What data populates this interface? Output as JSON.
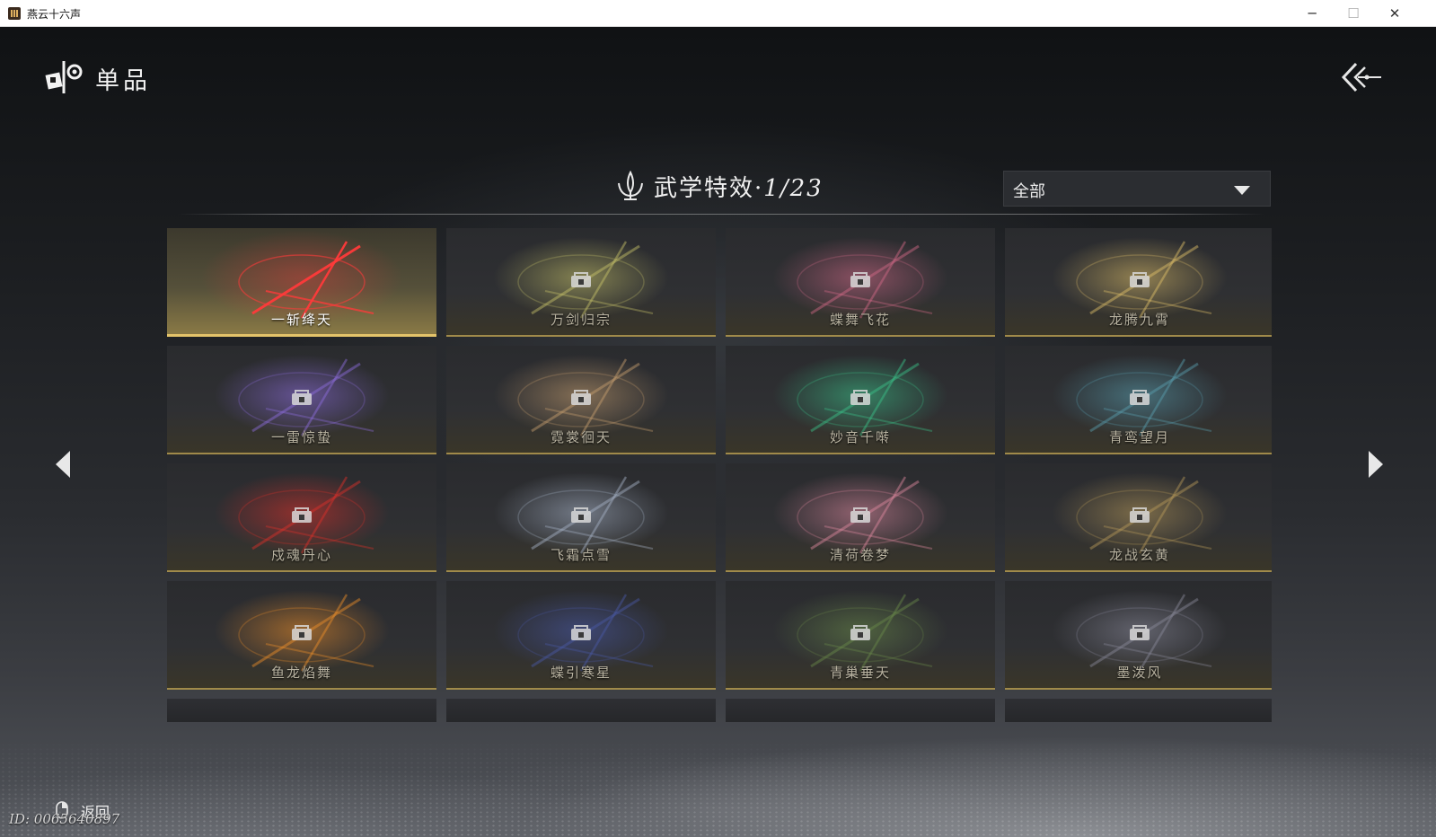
{
  "window": {
    "title": "燕云十六声",
    "minimize_glyph": "─",
    "maximize_glyph": "☐",
    "close_glyph": "✕"
  },
  "header": {
    "title": "单品",
    "icon": "item-shop-icon",
    "back_icon": "double-chevron-left-icon"
  },
  "section": {
    "title": "武学特效",
    "separator": "·",
    "count": "1/23",
    "icon": "lotus-emblem-icon"
  },
  "filter": {
    "selected": "全部"
  },
  "effects": [
    {
      "name": "一斩绛天",
      "locked": false,
      "art_color": "#ff3a3a"
    },
    {
      "name": "万剑归宗",
      "locked": true,
      "art_color": "#c9c46a"
    },
    {
      "name": "蝶舞飞花",
      "locked": true,
      "art_color": "#d46a88"
    },
    {
      "name": "龙腾九霄",
      "locked": true,
      "art_color": "#e2c26a"
    },
    {
      "name": "一雷惊蛰",
      "locked": true,
      "art_color": "#8f6ee0"
    },
    {
      "name": "霓裳徊天",
      "locked": true,
      "art_color": "#c8a070"
    },
    {
      "name": "妙音千啭",
      "locked": true,
      "art_color": "#3bc48a"
    },
    {
      "name": "青鸾望月",
      "locked": true,
      "art_color": "#5aa0b0"
    },
    {
      "name": "戍魂丹心",
      "locked": true,
      "art_color": "#e0302a"
    },
    {
      "name": "飞霜点雪",
      "locked": true,
      "art_color": "#a8b4c8"
    },
    {
      "name": "清荷卷梦",
      "locked": true,
      "art_color": "#e08aa0"
    },
    {
      "name": "龙战玄黄",
      "locked": true,
      "art_color": "#b89a5a"
    },
    {
      "name": "鱼龙焰舞",
      "locked": true,
      "art_color": "#f0902a"
    },
    {
      "name": "蝶引寒星",
      "locked": true,
      "art_color": "#4a5aa8"
    },
    {
      "name": "青巢垂天",
      "locked": true,
      "art_color": "#6a8a4a"
    },
    {
      "name": "墨泼风",
      "locked": true,
      "art_color": "#8a8a9a"
    }
  ],
  "footer": {
    "back_label": "返回",
    "user_id": "ID: 0065640897"
  },
  "colors": {
    "accent_gold": "#e4c46a",
    "text_light": "#f0f0f0"
  }
}
